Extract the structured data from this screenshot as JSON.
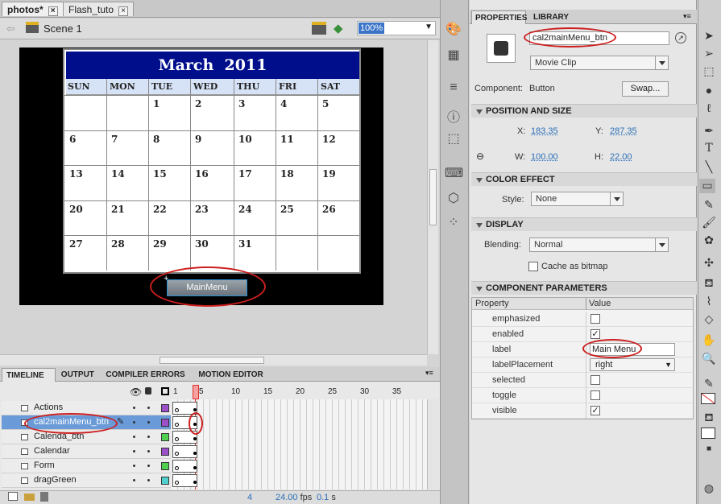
{
  "doc_tabs": [
    {
      "label": "photos*"
    },
    {
      "label": "Flash_tuto"
    }
  ],
  "scene": {
    "label": "Scene 1",
    "zoom": "100%"
  },
  "calendar": {
    "title": "March  2011",
    "days": [
      "SUN",
      "MON",
      "TUE",
      "WED",
      "THU",
      "FRI",
      "SAT"
    ],
    "weeks": [
      [
        "",
        "",
        "1",
        "2",
        "3",
        "4",
        "5"
      ],
      [
        "6",
        "7",
        "8",
        "9",
        "10",
        "11",
        "12"
      ],
      [
        "13",
        "14",
        "15",
        "16",
        "17",
        "18",
        "19"
      ],
      [
        "20",
        "21",
        "22",
        "23",
        "24",
        "25",
        "26"
      ],
      [
        "27",
        "28",
        "29",
        "30",
        "31",
        "",
        ""
      ]
    ]
  },
  "stage_button": {
    "label": "MainMenu"
  },
  "timeline": {
    "tabs": [
      "TIMELINE",
      "OUTPUT",
      "COMPILER ERRORS",
      "MOTION EDITOR"
    ],
    "frame_numbers": [
      "1",
      "5",
      "10",
      "15",
      "20",
      "25",
      "30",
      "35"
    ],
    "layers": [
      {
        "name": "Actions",
        "color": "#9b4fc9"
      },
      {
        "name": "cal2mainMenu_btn",
        "color": "#9b4fc9"
      },
      {
        "name": "Calenda_btn",
        "color": "#4fd14f"
      },
      {
        "name": "Calendar",
        "color": "#9b4fc9"
      },
      {
        "name": "Form",
        "color": "#4fd14f"
      },
      {
        "name": "dragGreen",
        "color": "#4fd1d1"
      }
    ],
    "status": {
      "frame": "4",
      "fps": "24.00",
      "fps_unit": "fps",
      "time": "0.1",
      "time_unit": "s"
    }
  },
  "properties": {
    "tabs": [
      "PROPERTIES",
      "LIBRARY"
    ],
    "instance_name": "cal2mainMenu_btn",
    "symbol_type": "Movie Clip",
    "component_label": "Component:",
    "component_value": "Button",
    "swap_label": "Swap...",
    "position_size": {
      "title": "POSITION AND SIZE",
      "x_label": "X:",
      "x": "183.35",
      "y_label": "Y:",
      "y": "287.35",
      "w_label": "W:",
      "w": "100.00",
      "h_label": "H:",
      "h": "22.00"
    },
    "color_effect": {
      "title": "COLOR EFFECT",
      "style_label": "Style:",
      "style": "None"
    },
    "display": {
      "title": "DISPLAY",
      "blending_label": "Blending:",
      "blending": "Normal",
      "cache_label": "Cache as bitmap"
    },
    "component_params": {
      "title": "COMPONENT PARAMETERS",
      "col_property": "Property",
      "col_value": "Value",
      "rows": [
        {
          "name": "emphasized",
          "type": "checkbox",
          "checked": false
        },
        {
          "name": "enabled",
          "type": "checkbox",
          "checked": true
        },
        {
          "name": "label",
          "type": "text",
          "value": "Main Menu"
        },
        {
          "name": "labelPlacement",
          "type": "select",
          "value": "right"
        },
        {
          "name": "selected",
          "type": "checkbox",
          "checked": false
        },
        {
          "name": "toggle",
          "type": "checkbox",
          "checked": false
        },
        {
          "name": "visible",
          "type": "checkbox",
          "checked": true
        }
      ]
    }
  },
  "colors": {
    "calendar_header": "#000e8c",
    "annotation": "#cc1f1f",
    "selected_layer": "#6a9bd8"
  }
}
